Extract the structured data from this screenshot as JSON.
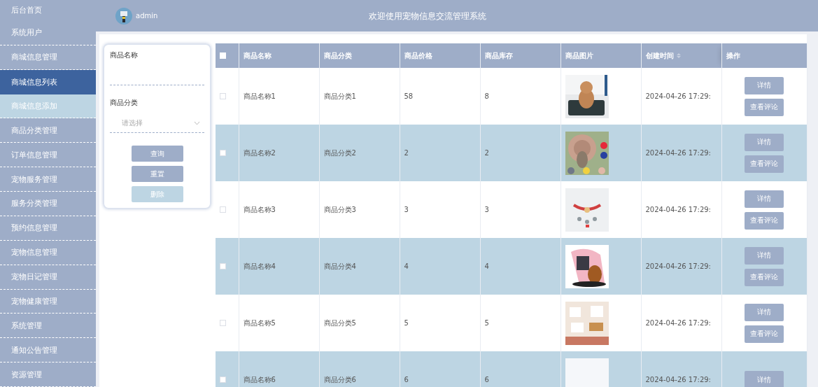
{
  "sidebar": {
    "items": [
      {
        "label": "后台首页",
        "selected": false
      },
      {
        "label": "系统用户",
        "selected": false
      },
      {
        "label": "商城信息管理",
        "selected": false,
        "expanded": true,
        "children": [
          {
            "label": "商城信息列表",
            "selected": true
          },
          {
            "label": "商城信息添加",
            "selected": false
          }
        ]
      },
      {
        "label": "商品分类管理",
        "selected": false
      },
      {
        "label": "订单信息管理",
        "selected": false
      },
      {
        "label": "宠物服务管理",
        "selected": false
      },
      {
        "label": "服务分类管理",
        "selected": false
      },
      {
        "label": "预约信息管理",
        "selected": false
      },
      {
        "label": "宠物信息管理",
        "selected": false
      },
      {
        "label": "宠物日记管理",
        "selected": false
      },
      {
        "label": "宠物健康管理",
        "selected": false
      },
      {
        "label": "系统管理",
        "selected": false
      },
      {
        "label": "通知公告管理",
        "selected": false
      },
      {
        "label": "资源管理",
        "selected": false
      }
    ]
  },
  "header": {
    "user": "admin",
    "title": "欢迎使用宠物信息交流管理系统"
  },
  "filter": {
    "fields": [
      {
        "label": "商品名称",
        "kind": "text"
      },
      {
        "label": "商品分类",
        "kind": "select",
        "placeholder": "请选择"
      }
    ],
    "buttons": [
      {
        "label": "查询",
        "disabled": false
      },
      {
        "label": "重置",
        "disabled": false
      },
      {
        "label": "删除",
        "disabled": true
      }
    ]
  },
  "table": {
    "select_all_checked": false,
    "columns": [
      "商品名称",
      "商品分类",
      "商品价格",
      "商品库存",
      "商品图片",
      "创建时间",
      "操作"
    ],
    "rows": [
      {
        "checked": false,
        "name": "商品名称1",
        "category": "商品分类1",
        "price": "58",
        "stock": "8",
        "image": {
          "kind": "picture"
        },
        "created": "2024-04-26 17:29:",
        "actions": [
          "详情",
          "查看评论"
        ]
      },
      {
        "checked": false,
        "name": "商品名称2",
        "category": "商品分类2",
        "price": "2",
        "stock": "2",
        "image": {
          "kind": "picture"
        },
        "created": "2024-04-26 17:29:",
        "actions": [
          "详情",
          "查看评论"
        ]
      },
      {
        "checked": false,
        "name": "商品名称3",
        "category": "商品分类3",
        "price": "3",
        "stock": "3",
        "image": {
          "kind": "picture"
        },
        "created": "2024-04-26 17:29:",
        "actions": [
          "详情",
          "查看评论"
        ]
      },
      {
        "checked": false,
        "name": "商品名称4",
        "category": "商品分类4",
        "price": "4",
        "stock": "4",
        "image": {
          "kind": "picture"
        },
        "created": "2024-04-26 17:29:",
        "actions": [
          "详情",
          "查看评论"
        ]
      },
      {
        "checked": false,
        "name": "商品名称5",
        "category": "商品分类5",
        "price": "5",
        "stock": "5",
        "image": {
          "kind": "picture"
        },
        "created": "2024-04-26 17:29:",
        "actions": [
          "详情",
          "查看评论"
        ]
      },
      {
        "checked": false,
        "name": "商品名称6",
        "category": "商品分类6",
        "price": "6",
        "stock": "6",
        "image": {
          "kind": "empty"
        },
        "created": "2024-04-26 17:29:",
        "actions": [
          "详情"
        ]
      }
    ]
  }
}
